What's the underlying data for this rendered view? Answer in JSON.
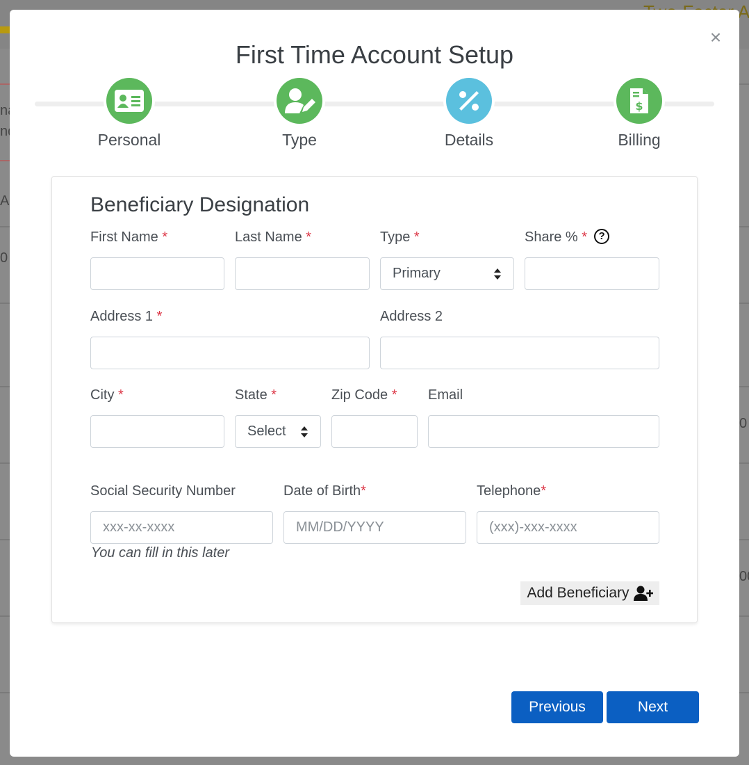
{
  "background": {
    "top_right_text": "Two-Factor A",
    "left_fragments": [
      "na",
      "nd",
      "A",
      "0"
    ],
    "right_fragments": [
      "0",
      "00"
    ]
  },
  "modal": {
    "title": "First Time Account Setup",
    "close_glyph": "×"
  },
  "stepper": {
    "steps": [
      {
        "label": "Personal",
        "icon": "id-card-icon",
        "color": "#5cb85c"
      },
      {
        "label": "Type",
        "icon": "user-edit-icon",
        "color": "#5cb85c"
      },
      {
        "label": "Details",
        "icon": "percent-icon",
        "color": "#5bc0de"
      },
      {
        "label": "Billing",
        "icon": "invoice-dollar-icon",
        "color": "#5cb85c"
      }
    ]
  },
  "form": {
    "section_title": "Beneficiary Designation",
    "required_mark": "*",
    "first_name": {
      "label": "First Name",
      "value": ""
    },
    "last_name": {
      "label": "Last Name",
      "value": ""
    },
    "type": {
      "label": "Type",
      "value": "Primary"
    },
    "share": {
      "label": "Share %",
      "value": "",
      "help_glyph": "?"
    },
    "address1": {
      "label": "Address 1",
      "value": ""
    },
    "address2": {
      "label": "Address 2",
      "value": ""
    },
    "city": {
      "label": "City",
      "value": ""
    },
    "state": {
      "label": "State",
      "value": "Select"
    },
    "zip": {
      "label": "Zip Code",
      "value": ""
    },
    "email": {
      "label": "Email",
      "value": ""
    },
    "ssn": {
      "label": "Social Security Number",
      "placeholder": "xxx-xx-xxxx",
      "hint": "You can fill in this later"
    },
    "dob": {
      "label": "Date of Birth",
      "placeholder": "MM/DD/YYYY"
    },
    "telephone": {
      "label": "Telephone",
      "placeholder": "(xxx)-xxx-xxxx"
    },
    "add_button": "Add Beneficiary"
  },
  "footer": {
    "previous": "Previous",
    "next": "Next"
  },
  "colors": {
    "primary": "#0b5fc2",
    "step_green": "#5cb85c",
    "step_blue": "#5bc0de",
    "required": "#dc3545"
  }
}
